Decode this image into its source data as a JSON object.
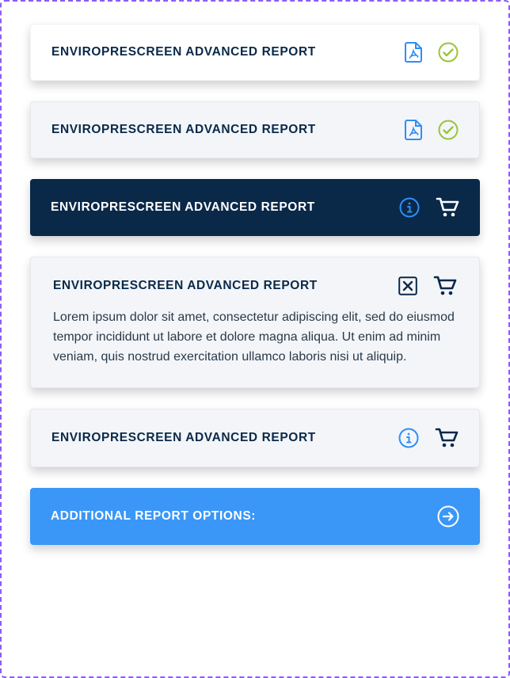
{
  "colors": {
    "navy": "#0a2949",
    "blue": "#3a97f7",
    "iconBlue": "#2f8ef6",
    "green": "#9ac43a",
    "white": "#ffffff"
  },
  "cards": [
    {
      "title": "ENVIROPRESCREEN ADVANCED REPORT"
    },
    {
      "title": "ENVIROPRESCREEN ADVANCED REPORT"
    },
    {
      "title": "ENVIROPRESCREEN ADVANCED REPORT"
    },
    {
      "title": "ENVIROPRESCREEN ADVANCED REPORT",
      "description": "Lorem ipsum dolor sit amet, consectetur adipiscing elit, sed do eiusmod tempor incididunt ut labore et dolore magna aliqua. Ut enim ad minim veniam, quis nostrud exercitation ullamco laboris nisi ut aliquip."
    },
    {
      "title": "ENVIROPRESCREEN ADVANCED REPORT"
    }
  ],
  "footer": {
    "label": "ADDITIONAL REPORT OPTIONS:"
  }
}
